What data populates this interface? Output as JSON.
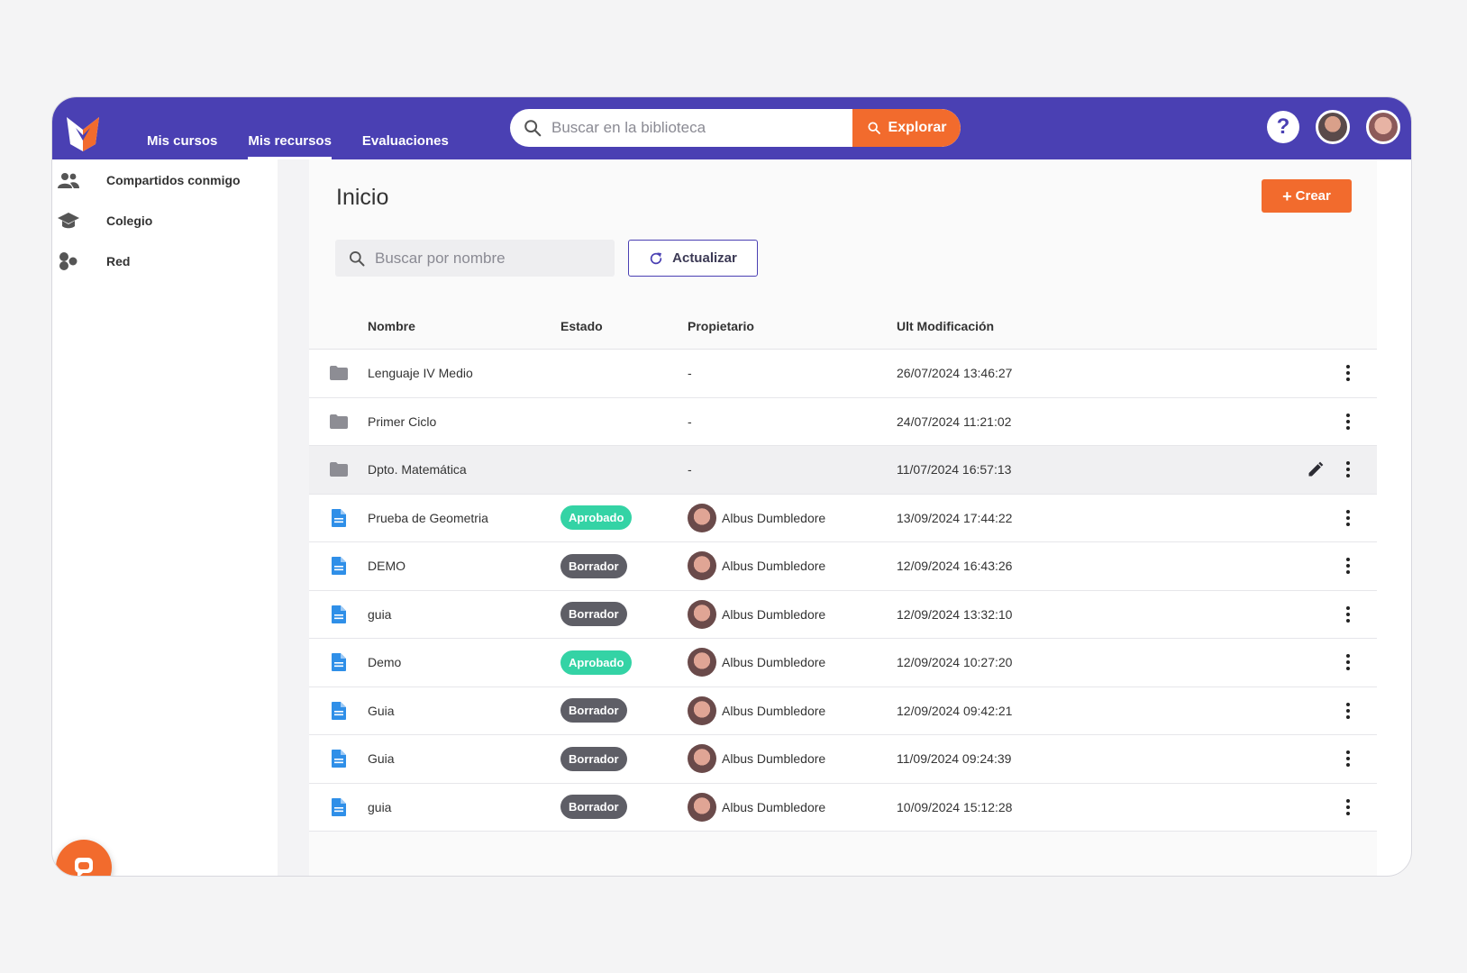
{
  "colors": {
    "brand": "#4a40b3",
    "accent": "#f26b2d",
    "approved": "#34d3a5",
    "draft": "#5e5e66"
  },
  "topbar": {
    "nav": [
      "Mis cursos",
      "Mis recursos",
      "Evaluaciones"
    ],
    "active_nav": "Mis recursos",
    "search_placeholder": "Buscar en la biblioteca",
    "explore_label": "Explorar",
    "help_label": "?"
  },
  "sidebar": {
    "items": [
      {
        "label": "Compartidos conmigo",
        "icon": "people-icon"
      },
      {
        "label": "Colegio",
        "icon": "graduation-cap-icon"
      },
      {
        "label": "Red",
        "icon": "network-icon"
      }
    ]
  },
  "main": {
    "title": "Inicio",
    "create_label": "Crear",
    "search_placeholder": "Buscar por nombre",
    "refresh_label": "Actualizar",
    "columns": [
      "Nombre",
      "Estado",
      "Propietario",
      "Ult Modificación"
    ],
    "rows": [
      {
        "type": "folder",
        "name": "Lenguaje IV Medio",
        "state": "",
        "owner": "-",
        "date": "26/07/2024 13:46:27"
      },
      {
        "type": "folder",
        "name": "Primer Ciclo",
        "state": "",
        "owner": "-",
        "date": "24/07/2024 11:21:02"
      },
      {
        "type": "folder",
        "name": "Dpto. Matemática",
        "state": "",
        "owner": "-",
        "date": "11/07/2024 16:57:13",
        "hover": true
      },
      {
        "type": "doc",
        "name": "Prueba de Geometria",
        "state": "Aprobado",
        "owner": "Albus Dumbledore",
        "date": "13/09/2024 17:44:22"
      },
      {
        "type": "doc",
        "name": "DEMO",
        "state": "Borrador",
        "owner": "Albus Dumbledore",
        "date": "12/09/2024 16:43:26"
      },
      {
        "type": "doc",
        "name": "guia",
        "state": "Borrador",
        "owner": "Albus Dumbledore",
        "date": "12/09/2024 13:32:10"
      },
      {
        "type": "doc",
        "name": "Demo",
        "state": "Aprobado",
        "owner": "Albus Dumbledore",
        "date": "12/09/2024 10:27:20"
      },
      {
        "type": "doc",
        "name": "Guia",
        "state": "Borrador",
        "owner": "Albus Dumbledore",
        "date": "12/09/2024 09:42:21"
      },
      {
        "type": "doc",
        "name": "Guia",
        "state": "Borrador",
        "owner": "Albus Dumbledore",
        "date": "11/09/2024 09:24:39"
      },
      {
        "type": "doc",
        "name": "guia",
        "state": "Borrador",
        "owner": "Albus Dumbledore",
        "date": "10/09/2024 15:12:28"
      }
    ]
  }
}
